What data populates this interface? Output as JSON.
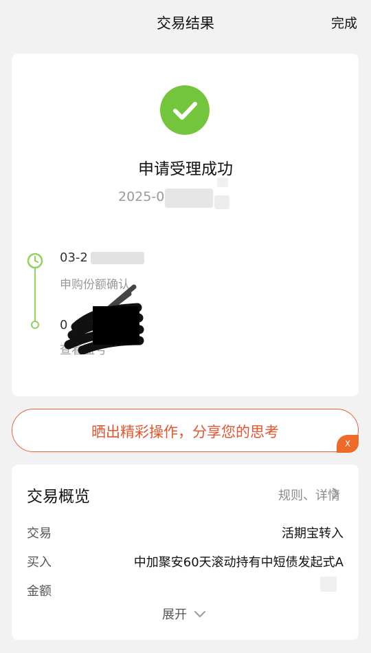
{
  "header": {
    "title": "交易结果",
    "done_label": "完成"
  },
  "result": {
    "title": "申请受理成功",
    "time": "2025-0",
    "icon": "check-circle-icon",
    "color": "#73c63b"
  },
  "timeline": {
    "steps": [
      {
        "date": "03-2",
        "desc": "申购份额确认",
        "icon": "clock-icon"
      },
      {
        "date": "0",
        "desc": "查看盈亏",
        "icon": "dot-icon"
      }
    ],
    "line_color": "#8fd35c"
  },
  "share": {
    "label": "晒出精彩操作，分享您的思考",
    "close_label": "X",
    "accent": "#e4552e"
  },
  "overview": {
    "title": "交易概览",
    "link_label": "规则、详情",
    "rows": [
      {
        "label": "交易",
        "value": "活期宝转入"
      },
      {
        "label": "买入",
        "value": "中加聚安60天滚动持有中短债发起式A"
      },
      {
        "label": "金额",
        "value": ""
      }
    ],
    "expand_label": "展开"
  }
}
